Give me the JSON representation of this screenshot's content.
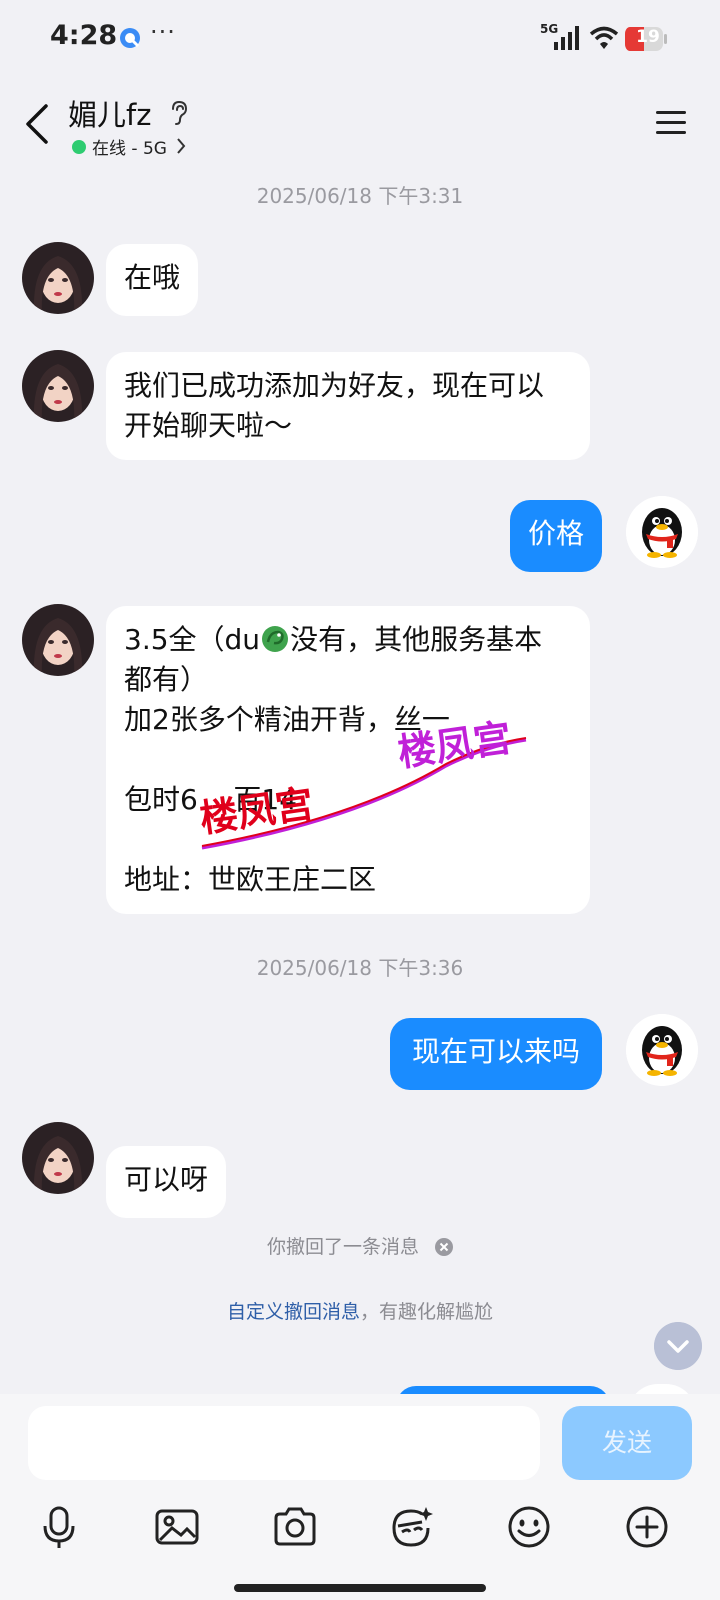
{
  "status_bar": {
    "time": "4:28",
    "more": "···",
    "network": "5G",
    "battery": "19"
  },
  "header": {
    "contact_name": "媚儿fz",
    "status": "在线 - 5G",
    "online_color": "#2ecc71"
  },
  "messages": [
    {
      "type": "timestamp",
      "text": "2025/06/18 下午3:31"
    },
    {
      "type": "incoming",
      "text": "在哦"
    },
    {
      "type": "incoming",
      "text": "我们已成功添加为好友，现在可以\n开始聊天啦～"
    },
    {
      "type": "outgoing",
      "text": "价格"
    },
    {
      "type": "incoming",
      "line1_prefix": "3.5全（du",
      "line1_suffix": "没有，其他服务基本",
      "rest": "都有）\n加2张多个精油开背，丝一\n\n包时6    百14\n\n地址：世欧王庄二区",
      "emoji": "dragon-emoji"
    },
    {
      "type": "timestamp",
      "text": "2025/06/18 下午3:36"
    },
    {
      "type": "outgoing",
      "text": "现在可以来吗"
    },
    {
      "type": "incoming",
      "text": "可以呀"
    }
  ],
  "watermark": {
    "text1": "楼凤宫",
    "text2": "楼凤宫",
    "color1": "#e0001b",
    "color2": "#c020d8"
  },
  "recall": {
    "notice": "你撤回了一条消息",
    "tip_link": "自定义撤回消息",
    "tip_rest": "，有趣化解尴尬"
  },
  "input": {
    "placeholder": "",
    "send_label": "发送"
  },
  "toolbar": [
    "microphone-icon",
    "image-icon",
    "camera-icon",
    "sticker-icon",
    "emoji-icon",
    "plus-icon"
  ],
  "colors": {
    "outgoing_bubble": "#1a8cff",
    "send_button": "#8cc9ff",
    "background": "#f1f1f5"
  }
}
